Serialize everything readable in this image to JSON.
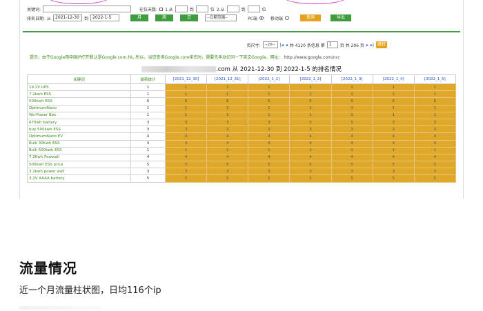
{
  "filters": {
    "keyword_label": "关键词:",
    "rank_days_label": "在位天数:",
    "from1": "1.从",
    "to1": "到",
    "pos1": "位",
    "from2": "2.从",
    "to2": "到",
    "pos2": "位",
    "date_label": "排名日期:",
    "date_from_prefix": "从",
    "date_from": "2021-12-30",
    "date_to_prefix": "到",
    "date_to": "2022-1-5",
    "btn_month": "月",
    "btn_week": "周",
    "btn_day": "日",
    "date_range_select": "--日期范围--",
    "pc_label": "PC端",
    "mobile_label": "移动端",
    "query_button": "查询",
    "export_button": "导出"
  },
  "pager": {
    "page_size_label": "页尺寸:",
    "page_size": "--20--",
    "summary_prefix": "共 4120 条信息 第",
    "page": "1",
    "summary_suffix": "页 共 206 页",
    "jump_button": "跳转"
  },
  "tip": {
    "text": "提示：由于Google用中国IP打开默认是Google.com.hk, 所以，当您查询Google.com排名时，需要先手动访问一下英文Google，网址：",
    "url": "http://www.google.com/ncr"
  },
  "table": {
    "title": ".com 从 2021-12-30 到 2022-1-5 的排名情况",
    "headers": [
      "关键词",
      "最新统计",
      "[2021_12_30]",
      "[2021_12_31]",
      "[2022_1_1]",
      "[2022_1_2]",
      "[2022_1_3]",
      "[2022_1_4]",
      "[2022_1_5]"
    ],
    "rows": [
      {
        "kw": "19.2V UPS",
        "latest": "1",
        "ranks": [
          "1",
          "1",
          "1",
          "1",
          "1",
          "1",
          "1"
        ]
      },
      {
        "kw": "7.2kwh ESS",
        "latest": "1",
        "ranks": [
          "1",
          "1",
          "1",
          "1",
          "1",
          "1",
          "1"
        ]
      },
      {
        "kw": "500kwh ESS",
        "latest": "6",
        "ranks": [
          "6",
          "6",
          "6",
          "6",
          "6",
          "6",
          "6"
        ]
      },
      {
        "kw": "OptimumNano",
        "latest": "1",
        "ranks": [
          "1",
          "1",
          "1",
          "1",
          "1",
          "1",
          "1"
        ]
      },
      {
        "kw": "Wo-Power Box",
        "latest": "1",
        "ranks": [
          "1",
          "1",
          "1",
          "1",
          "1",
          "1",
          "1"
        ]
      },
      {
        "kw": "670wh battery",
        "latest": "3",
        "ranks": [
          "3",
          "3",
          "3",
          "5",
          "5",
          "3",
          "3"
        ]
      },
      {
        "kw": "buy 500kwh ESS",
        "latest": "3",
        "ranks": [
          "3",
          "3",
          "3",
          "3",
          "3",
          "3",
          "3"
        ]
      },
      {
        "kw": "OptimumNano EV",
        "latest": "4",
        "ranks": [
          "4",
          "4",
          "4",
          "4",
          "4",
          "4",
          "4"
        ]
      },
      {
        "kw": "Bulk 30Kwh ESS",
        "latest": "4",
        "ranks": [
          "4",
          "4",
          "4",
          "4",
          "4",
          "4",
          "4"
        ]
      },
      {
        "kw": "Bulk 500kwh ESS",
        "latest": "1",
        "ranks": [
          "1",
          "1",
          "1",
          "1",
          "1",
          "1",
          "1"
        ]
      },
      {
        "kw": "7.2Kwh Powwall",
        "latest": "4",
        "ranks": [
          "4",
          "4",
          "4",
          "4",
          "4",
          "4",
          "4"
        ]
      },
      {
        "kw": "500kwh ESS price",
        "latest": "5",
        "ranks": [
          "5",
          "5",
          "5",
          "5",
          "5",
          "5",
          "5"
        ]
      },
      {
        "kw": "3.2kwh power wall",
        "latest": "3",
        "ranks": [
          "3",
          "3",
          "3",
          "3",
          "3",
          "3",
          "3"
        ]
      },
      {
        "kw": "3.2V AAAA battery",
        "latest": "5",
        "ranks": [
          "5",
          "5",
          "5",
          "5",
          "5",
          "5",
          "5"
        ]
      }
    ]
  },
  "section": {
    "heading": "流量情况",
    "subtitle": "近一个月流量柱状图，日均116个ip"
  },
  "colors": {
    "green": "#3f9d3f",
    "orange": "#e5a11b",
    "rank_cell": "#dfa82a",
    "ellipse": "#c83cc8"
  }
}
